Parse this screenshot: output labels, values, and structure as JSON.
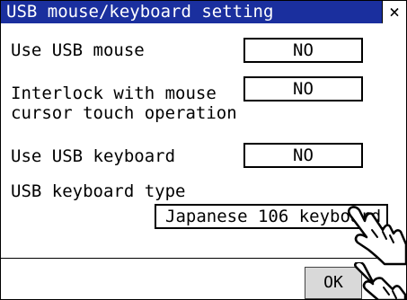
{
  "window": {
    "title": "USB mouse/keyboard setting",
    "close_glyph": "×"
  },
  "settings": {
    "use_usb_mouse": {
      "label": "Use USB mouse",
      "value": "NO"
    },
    "interlock": {
      "label": "Interlock with mouse\ncursor touch operation",
      "value": "NO"
    },
    "use_usb_keyboard": {
      "label": "Use USB keyboard",
      "value": "NO"
    },
    "keyboard_type": {
      "label": "USB keyboard type",
      "value": "Japanese 106 keyboard"
    }
  },
  "footer": {
    "ok_label": "OK"
  },
  "colors": {
    "titlebar": "#1a2f9e",
    "button_gray": "#d9d9d9"
  },
  "icons": {
    "pointer": "hand-pointer-icon"
  }
}
